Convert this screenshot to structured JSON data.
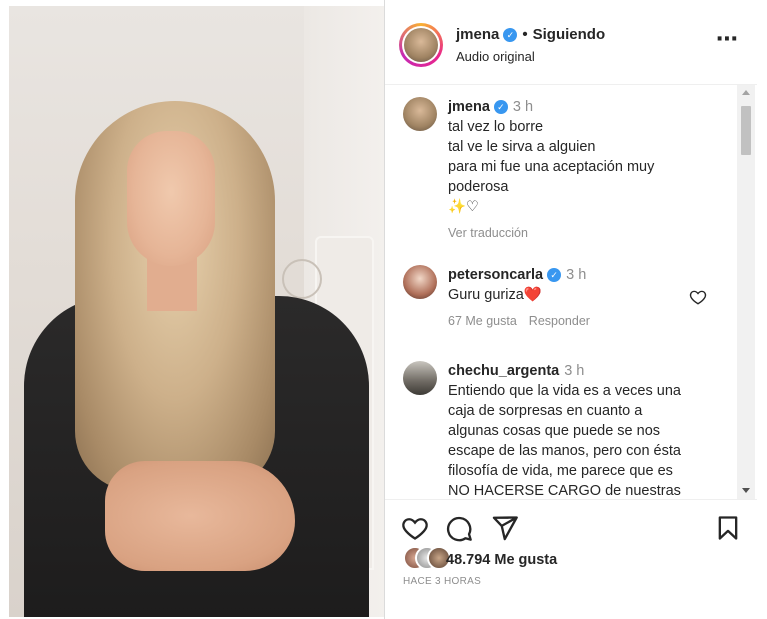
{
  "post": {
    "username": "jmena",
    "follow_separator": "•",
    "follow_status": "Siguiendo",
    "audio": "Audio original",
    "more_icon": "⋯"
  },
  "comments": [
    {
      "username": "jmena",
      "time": "3 h",
      "lines": [
        "tal vez lo borre",
        "tal ve le sirva a alguien",
        "para mi fue una aceptación muy",
        "poderosa",
        "✨♡"
      ],
      "translate": "Ver traducción"
    },
    {
      "username": "petersoncarla",
      "time": "3 h",
      "text": "Guru guriza❤️",
      "likes": "67 Me gusta",
      "reply": "Responder"
    },
    {
      "username": "chechu_argenta",
      "time": "3 h",
      "lines": [
        "Entiendo que la vida es a veces una",
        "caja de sorpresas en cuanto a",
        "algunas cosas que puede se nos",
        "escape de las manos, pero con ésta",
        "filosofía de vida, me parece que es",
        "NO HACERSE CARGO de nuestras"
      ]
    }
  ],
  "footer": {
    "likes_count": "48.794",
    "likes_label": "Me gusta",
    "time_ago": "HACE 3 HORAS"
  },
  "icons": {
    "like": "heart-icon",
    "comment": "comment-icon",
    "share": "share-icon",
    "save": "bookmark-icon",
    "verified": "verified-badge-icon"
  },
  "colors": {
    "verified": "#3897f0",
    "text": "#262626",
    "muted": "#8e8e8e",
    "heart_red": "#e0245e"
  }
}
